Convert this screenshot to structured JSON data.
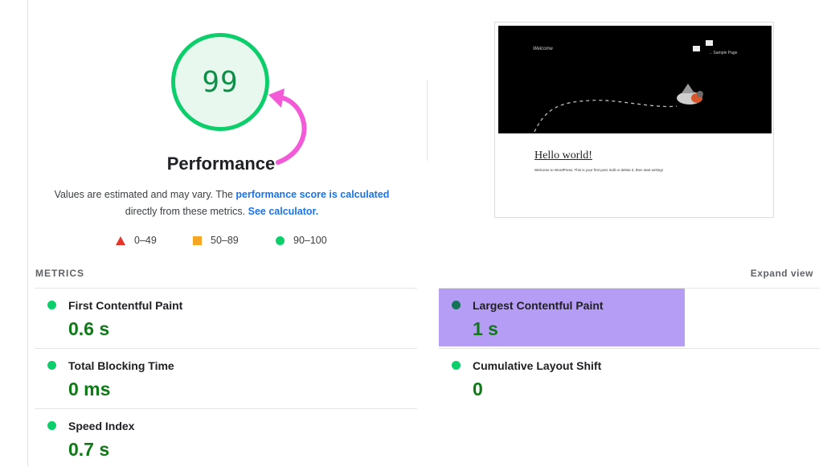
{
  "score": {
    "value": "99",
    "title": "Performance",
    "ring_color": "#0cce6b",
    "fill_color": "#e8f8ef"
  },
  "description": {
    "text_before": "Values are estimated and may vary. The ",
    "link1": "performance score is calculated",
    "text_middle": "directly from these metrics. ",
    "link2": "See calculator."
  },
  "legend": [
    {
      "icon": "red-triangle-icon",
      "range": "0–49",
      "color": "#e8332b"
    },
    {
      "icon": "orange-square-icon",
      "range": "50–89",
      "color": "#f5a623"
    },
    {
      "icon": "green-circle-icon",
      "range": "90–100",
      "color": "#0cce6b"
    }
  ],
  "annotation": {
    "icon": "curved-arrow-icon",
    "color": "#f35ad8"
  },
  "screenshot": {
    "welcome": "Welcome",
    "sample_page": "→ Sample Page",
    "post_title": "Hello world!",
    "post_body": "Welcome to WordPress. This is your first post. Edit or delete it, then start writing!"
  },
  "metrics": {
    "heading": "METRICS",
    "expand_label": "Expand view",
    "items": [
      {
        "label": "First Contentful Paint",
        "value": "0.6 s"
      },
      {
        "label": "Largest Contentful Paint",
        "value": "1 s",
        "highlight_color": "#b59cf5"
      },
      {
        "label": "Total Blocking Time",
        "value": "0 ms"
      },
      {
        "label": "Cumulative Layout Shift",
        "value": "0"
      },
      {
        "label": "Speed Index",
        "value": "0.7 s"
      }
    ]
  }
}
